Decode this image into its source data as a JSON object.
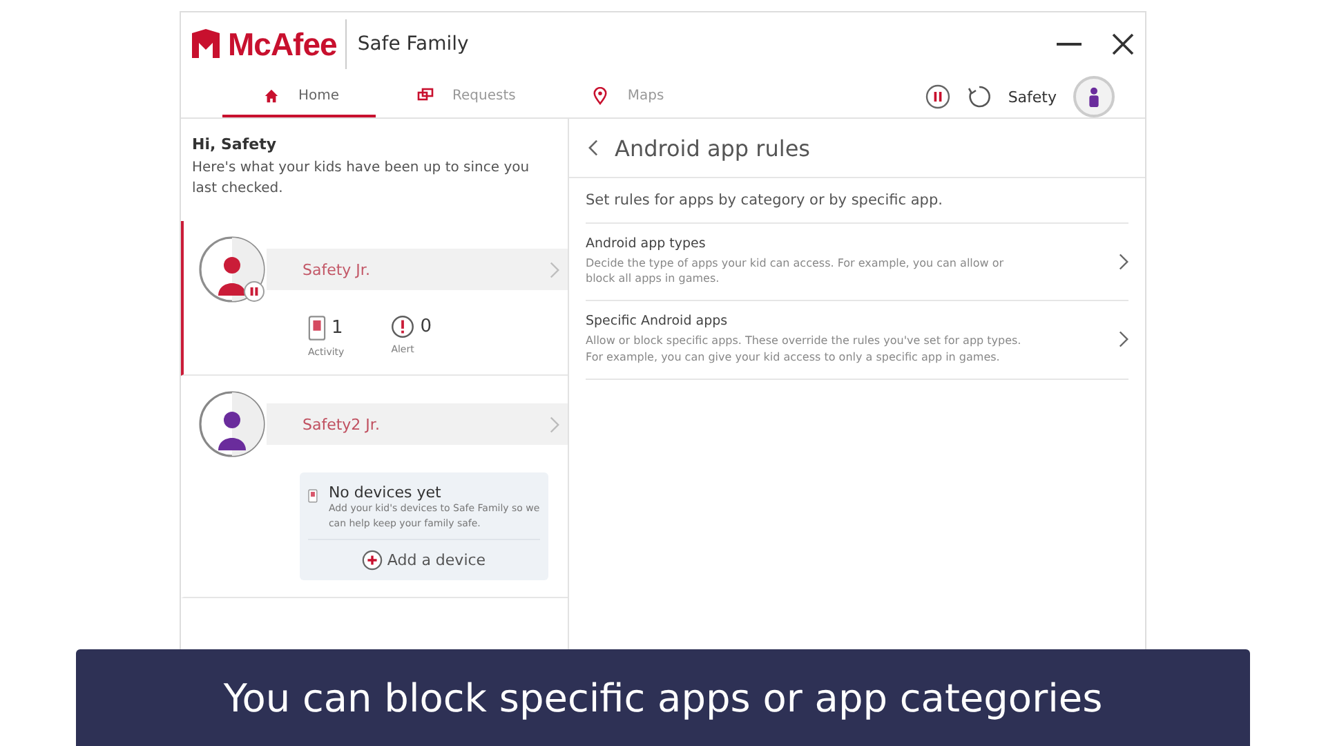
{
  "window": {
    "brand": "McAfee",
    "product": "Safe Family"
  },
  "tabs": [
    {
      "label": "Home",
      "kind": "home",
      "selected": true
    },
    {
      "label": "Requests",
      "kind": "requests",
      "selected": false
    },
    {
      "label": "Maps",
      "kind": "maps",
      "selected": false
    }
  ],
  "account": {
    "paused": true,
    "name": "Safety"
  },
  "sidebar": {
    "greeting": "Hi, Safety",
    "intro": "Here's what your kids have been up to since you last checked.",
    "kids": [
      {
        "name": "Safety Jr.",
        "color": "#c8102e",
        "selected": true,
        "paused": true,
        "stats": [
          {
            "kind": "activity",
            "value": "1",
            "label": "Activity"
          },
          {
            "kind": "alert",
            "value": "0",
            "label": "Alert"
          }
        ]
      },
      {
        "name": "Safety2 Jr.",
        "color": "#6a2c9c",
        "selected": false,
        "paused": false,
        "no_devices": {
          "title": "No devices yet",
          "text": "Add your kid's devices to Safe Family so we can help keep your family safe.",
          "action": "Add a device"
        }
      }
    ]
  },
  "panel": {
    "title": "Android app rules",
    "intro": "Set rules for apps by category or by specific app.",
    "rules": [
      {
        "title": "Android app types",
        "description": "Decide the type of apps your kid can access. For example, you can allow or block all apps in games."
      },
      {
        "title": "Specific Android apps",
        "description": "Allow or block specific apps. These override the rules you've set for app types. For example, you can give your kid access to only a specific app in games."
      }
    ]
  },
  "caption": "You can block specific apps or app categories"
}
